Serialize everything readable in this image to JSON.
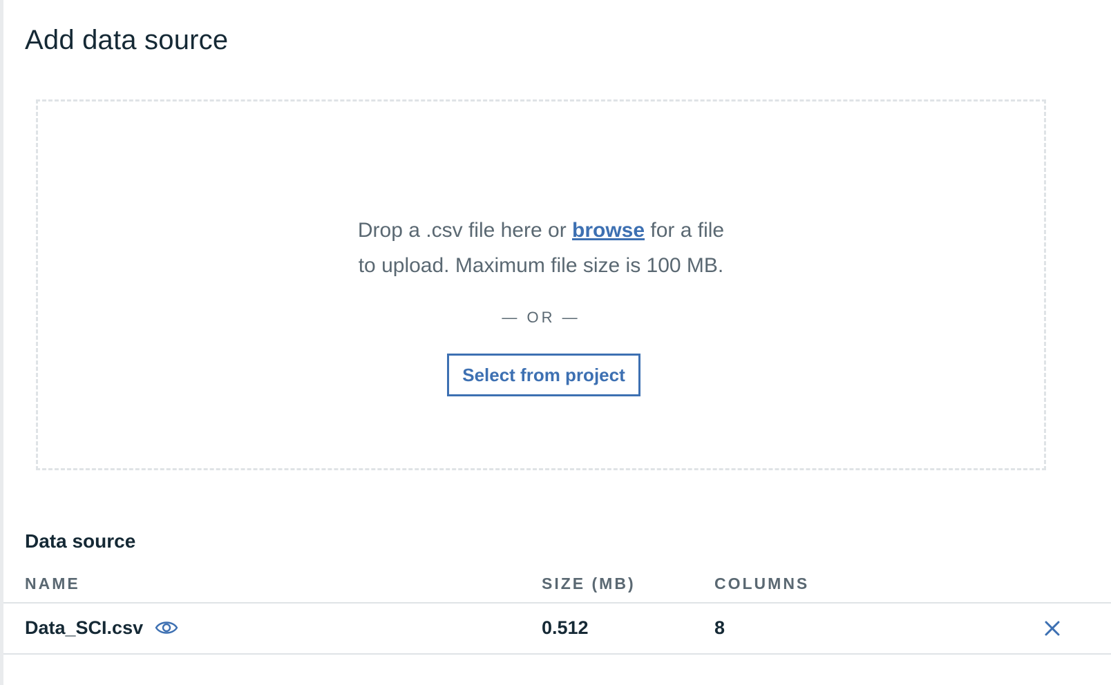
{
  "page": {
    "title": "Add data source"
  },
  "dropzone": {
    "text_before_link": "Drop a .csv file here or ",
    "browse_label": "browse",
    "text_after_link": " for a file",
    "line2": "to upload. Maximum file size is 100 MB.",
    "or_divider": "— OR —",
    "select_button_label": "Select from project"
  },
  "data_source": {
    "section_title": "Data source",
    "columns": {
      "name": "NAME",
      "size": "SIZE (MB)",
      "columns": "COLUMNS"
    },
    "rows": [
      {
        "name": "Data_SCI.csv",
        "size": "0.512",
        "columns": "8",
        "preview_icon": "eye-icon",
        "remove_icon": "close-icon"
      }
    ]
  },
  "colors": {
    "accent": "#3d70b2",
    "text_primary": "#152935",
    "text_secondary": "#5a6872",
    "border": "#dfe3e6"
  }
}
